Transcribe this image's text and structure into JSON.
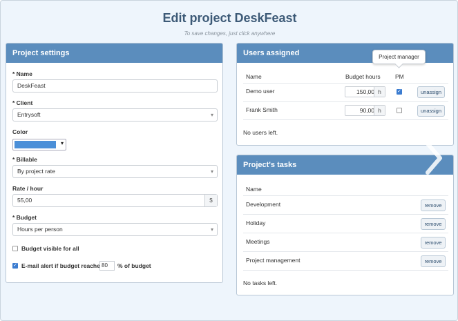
{
  "page": {
    "title": "Edit project DeskFeast",
    "subtitle": "To save changes, just click anywhere"
  },
  "settings": {
    "heading": "Project settings",
    "name_label": "* Name",
    "name_value": "DeskFeast",
    "client_label": "* Client",
    "client_value": "Entrysoft",
    "color_label": "Color",
    "color_value": "#4a8fd8",
    "billable_label": "* Billable",
    "billable_value": "By project rate",
    "rate_label": "Rate / hour",
    "rate_value": "55,00",
    "rate_currency": "$",
    "budget_label": "* Budget",
    "budget_value": "Hours per person",
    "budget_visible_label": "Budget visible for all",
    "budget_visible_checked": false,
    "email_alert_label": "E-mail alert if budget reaches",
    "email_alert_checked": true,
    "email_alert_value": "80",
    "email_alert_suffix": "% of budget"
  },
  "users": {
    "heading": "Users assigned",
    "col_name": "Name",
    "col_budget": "Budget hours",
    "col_pm": "PM",
    "tooltip": "Project manager",
    "rows": [
      {
        "name": "Demo user",
        "hours": "150,00",
        "unit": "h",
        "pm": true,
        "action": "unassign"
      },
      {
        "name": "Frank Smith",
        "hours": "90,00",
        "unit": "h",
        "pm": false,
        "action": "unassign"
      }
    ],
    "empty_note": "No users left."
  },
  "tasks": {
    "heading": "Project's tasks",
    "col_name": "Name",
    "rows": [
      {
        "name": "Development",
        "action": "remove"
      },
      {
        "name": "Holiday",
        "action": "remove"
      },
      {
        "name": "Meetings",
        "action": "remove"
      },
      {
        "name": "Project management",
        "action": "remove"
      }
    ],
    "empty_note": "No tasks left."
  },
  "icons": {
    "next": "chevron-right-icon",
    "select_caret": "caret-down-icon",
    "checkbox_check": "check-icon"
  }
}
